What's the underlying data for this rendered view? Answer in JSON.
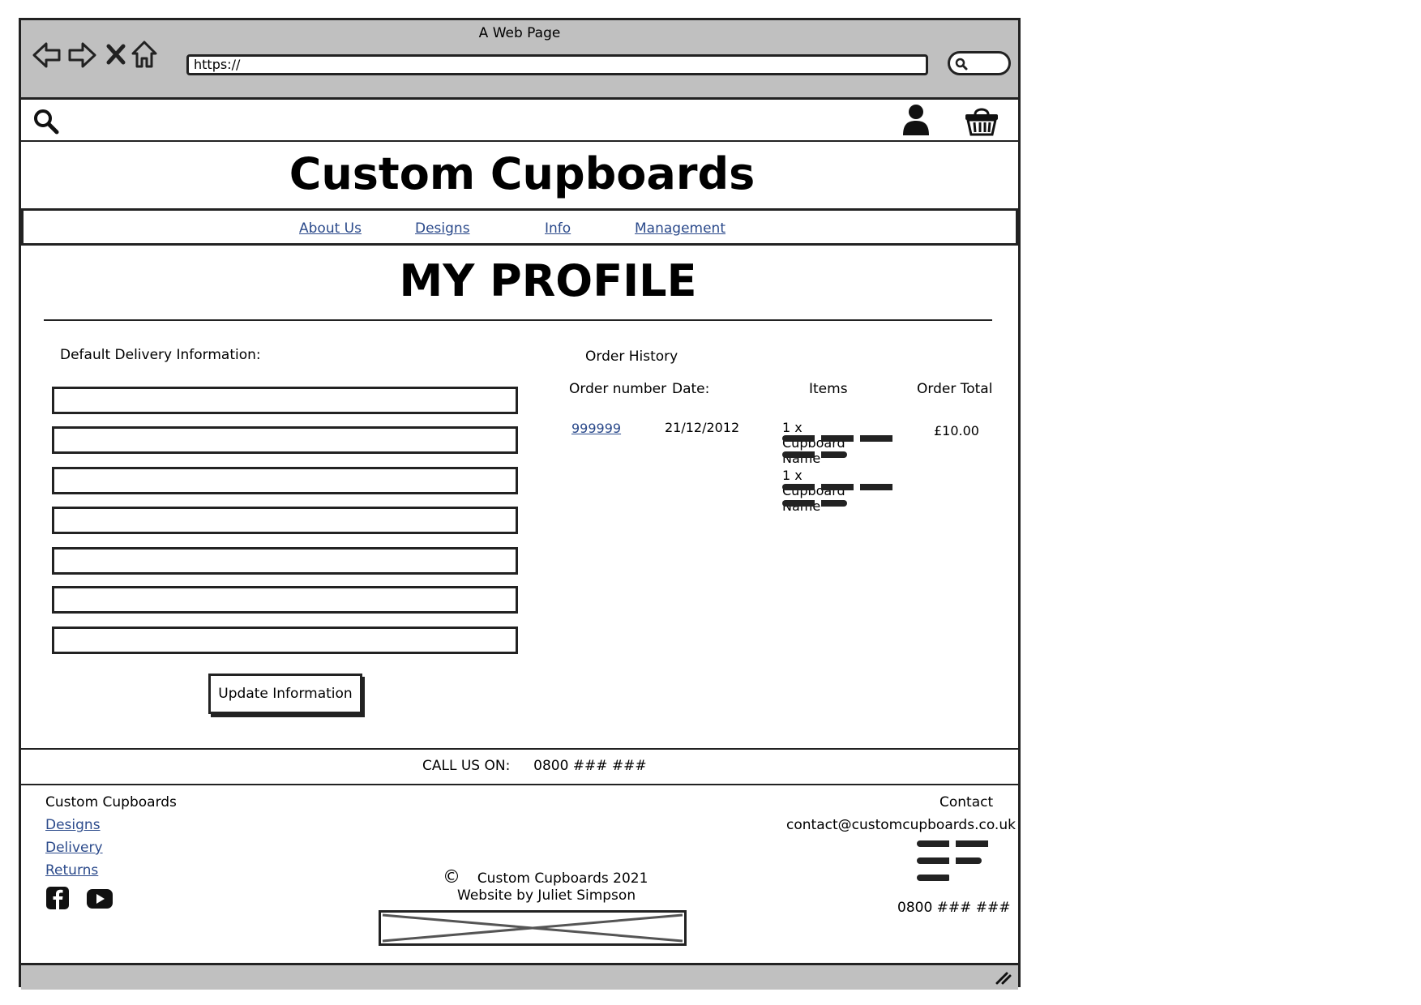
{
  "browser": {
    "window_title": "A Web Page",
    "url": "https://"
  },
  "header": {
    "site_title": "Custom Cupboards",
    "nav": [
      {
        "label": "About Us"
      },
      {
        "label": "Designs"
      },
      {
        "label": "Info"
      },
      {
        "label": "Management"
      }
    ]
  },
  "page": {
    "heading": "MY PROFILE"
  },
  "delivery": {
    "label": "Default Delivery Information:",
    "button_label": "Update Information"
  },
  "orders": {
    "title": "Order History",
    "columns": [
      "Order number",
      "Date:",
      "Items",
      "Order Total"
    ],
    "rows": [
      {
        "order_number": "999999",
        "date": "21/12/2012",
        "items": [
          "1 x Cupboard Name",
          "1 x Cupboard Name"
        ],
        "total": "£10.00"
      }
    ]
  },
  "call": {
    "label": "CALL US ON:",
    "number": "0800 ### ###"
  },
  "footer": {
    "brand": "Custom Cupboards",
    "links": [
      "Designs",
      "Delivery",
      "Returns"
    ],
    "copyright_symbol": "©",
    "copyright": "Custom Cupboards 2021",
    "credit": "Website by Juliet Simpson",
    "contact_title": "Contact",
    "contact_email": "contact@customcupboards.co.uk",
    "contact_phone": "0800 ### ###"
  },
  "icons": {
    "back": "back-arrow-icon",
    "forward": "forward-arrow-icon",
    "stop": "close-icon",
    "home": "home-icon",
    "search": "search-icon",
    "user": "user-icon",
    "basket": "basket-icon",
    "facebook": "facebook-icon",
    "youtube": "youtube-icon",
    "resize": "resize-grip-icon"
  },
  "colors": {
    "link": "#2b4a8b",
    "chrome": "#c0c0c0",
    "stroke": "#222222"
  }
}
